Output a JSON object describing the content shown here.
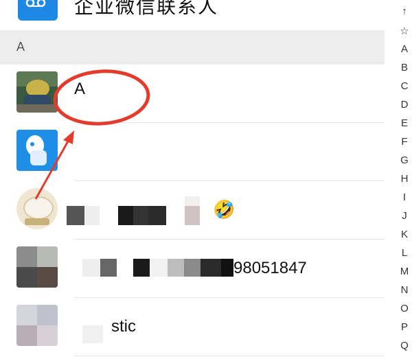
{
  "top_item": {
    "label": "企业微信联系人",
    "icon": "wecom-icon"
  },
  "section": {
    "letter": "A"
  },
  "contacts": [
    {
      "name": "A",
      "avatar": "avatar-photo-plush"
    },
    {
      "name": "",
      "avatar": "avatar-blue-cartoon"
    },
    {
      "name": "",
      "emoji": "🤣",
      "avatar": "avatar-round-sticker"
    },
    {
      "name_visible_suffix": "98051847",
      "avatar": "avatar-blurred-photo"
    },
    {
      "name_visible_suffix": "stic",
      "avatar": "avatar-blurred-gray"
    }
  ],
  "index_bar": {
    "items": [
      "↑",
      "☆",
      "A",
      "B",
      "C",
      "D",
      "E",
      "F",
      "G",
      "H",
      "I",
      "J",
      "K",
      "L",
      "M",
      "N",
      "O",
      "P",
      "Q"
    ]
  },
  "colors": {
    "annotation_red": "#e53b2c",
    "section_bg": "#ededed",
    "wecom_blue": "#1e88e5"
  }
}
